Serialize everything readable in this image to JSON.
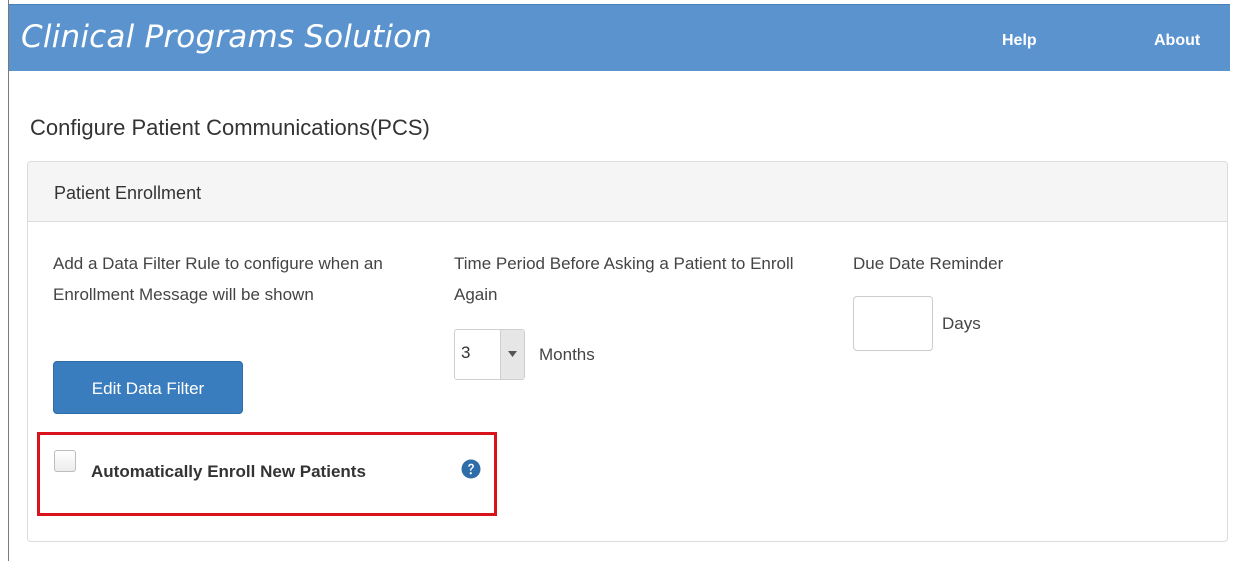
{
  "header": {
    "brand": "Clinical Programs Solution",
    "nav": {
      "help_label": "Help",
      "about_label": "About"
    }
  },
  "page": {
    "title": "Configure Patient Communications(PCS)"
  },
  "panel": {
    "title": "Patient Enrollment",
    "data_filter": {
      "description": "Add a Data Filter Rule to configure when an Enrollment Message will be shown",
      "button_label": "Edit Data Filter"
    },
    "time_period": {
      "label": "Time Period Before Asking a Patient to Enroll Again",
      "selected_value": "3",
      "unit_label": "Months"
    },
    "due_date_reminder": {
      "label": "Due Date Reminder",
      "value": "",
      "unit_label": "Days"
    },
    "auto_enroll": {
      "label": "Automatically Enroll New Patients",
      "checked": false,
      "help_icon": "question-circle-icon"
    }
  },
  "colors": {
    "navbar": "#5b93cf",
    "primary_button": "#3a7dbf",
    "highlight_border": "#d9121b",
    "help_icon": "#2f6da9"
  }
}
